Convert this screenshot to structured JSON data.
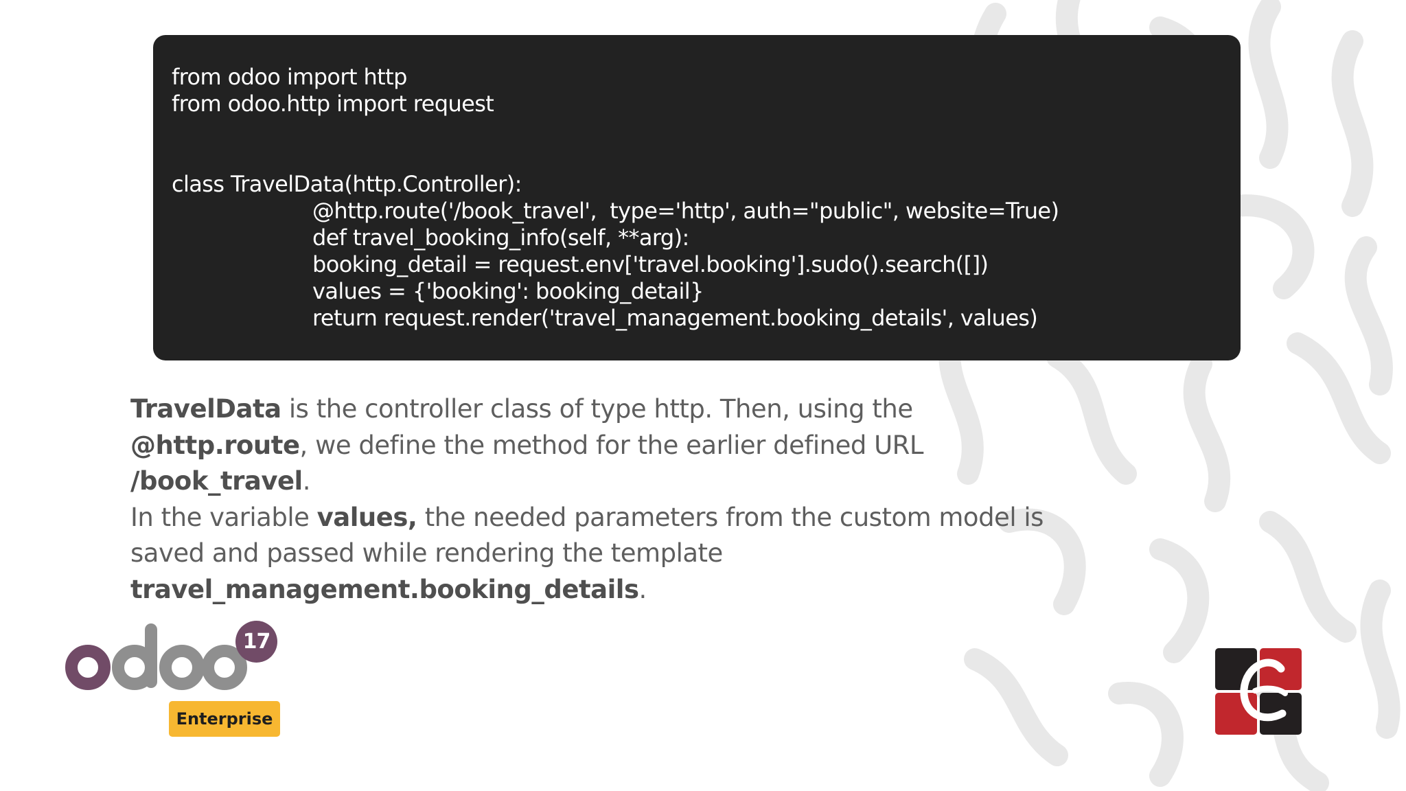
{
  "code": {
    "lines": [
      {
        "text": "from odoo import http",
        "indent": false
      },
      {
        "text": "from odoo.http import request",
        "indent": false
      },
      {
        "text": "",
        "indent": false
      },
      {
        "text": "",
        "indent": false
      },
      {
        "text": "class TravelData(http.Controller):",
        "indent": false
      },
      {
        "text": "@http.route('/book_travel',  type='http', auth=\"public\", website=True)",
        "indent": true
      },
      {
        "text": "def travel_booking_info(self, **arg):",
        "indent": true
      },
      {
        "text": "booking_detail = request.env['travel.booking'].sudo().search([])",
        "indent": true
      },
      {
        "text": "values = {'booking': booking_detail}",
        "indent": true
      },
      {
        "text": "return request.render('travel_management.booking_details', values)",
        "indent": true
      }
    ]
  },
  "description": {
    "p1": {
      "b1": "TravelData",
      "t1": " is the controller class of type http. Then, using the ",
      "b2": "@http.route",
      "t2": ", we define the method for the earlier defined URL ",
      "b3": "/book_travel",
      "t3": "."
    },
    "p2": {
      "t1": "In the variable ",
      "b1": "values,",
      "t2": " the needed parameters from the custom model is saved and passed while rendering the template ",
      "b2": "travel_management.booking_details",
      "t3": "."
    }
  },
  "logo": {
    "version": "17",
    "edition": "Enterprise",
    "wordmark": "odoo"
  },
  "colors": {
    "code_bg": "#222222",
    "odoo_purple": "#714b67",
    "odoo_gray": "#8f8f8f",
    "enterprise_yellow": "#f7b731",
    "brand_red": "#c1272d",
    "brand_dark": "#231f20"
  }
}
